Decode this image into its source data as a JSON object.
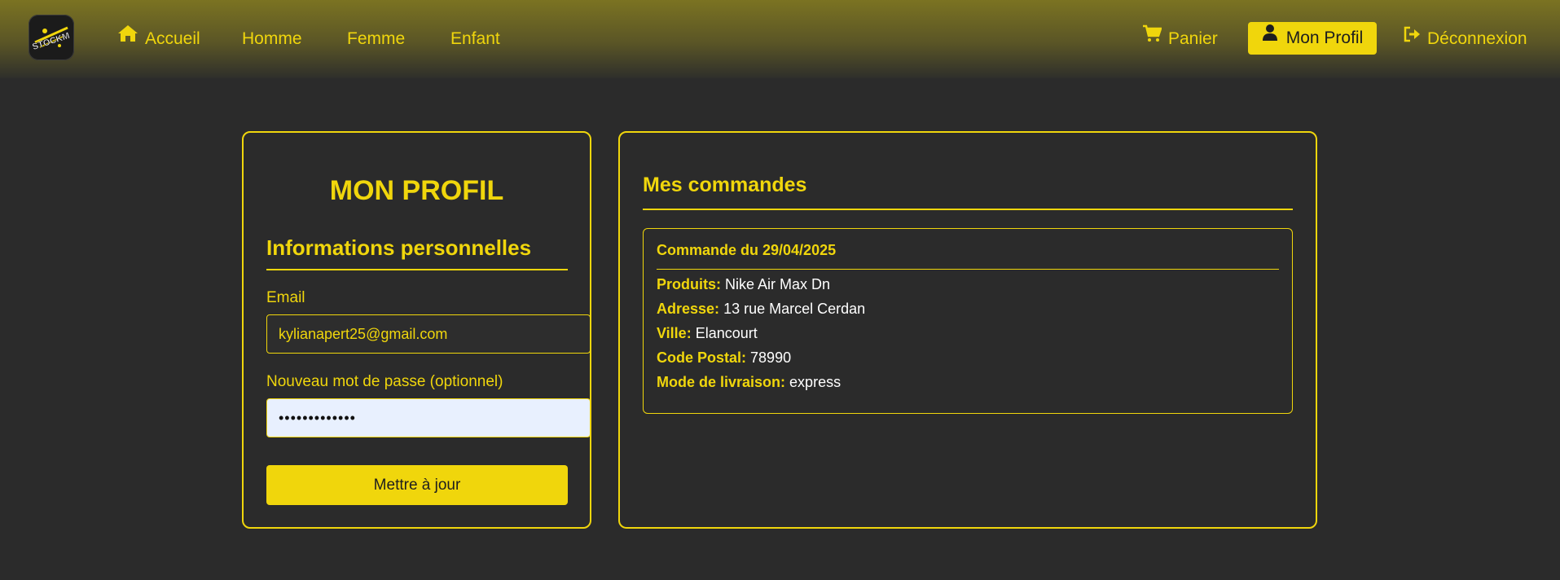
{
  "brand": {
    "logo_text": "STOCKM"
  },
  "nav": {
    "home": "Accueil",
    "men": "Homme",
    "women": "Femme",
    "kids": "Enfant",
    "cart": "Panier",
    "profile": "Mon Profil",
    "logout": "Déconnexion"
  },
  "icons": {
    "home": "home-icon",
    "cart": "cart-icon",
    "user": "user-icon",
    "logout": "logout-icon"
  },
  "colors": {
    "accent": "#f0d60c",
    "background": "#2b2b2b",
    "navbar_top": "#7b7322"
  },
  "profile": {
    "title": "MON PROFIL",
    "section_title": "Informations personnelles",
    "email_label": "Email",
    "email_value": "kylianapert25@gmail.com",
    "password_label": "Nouveau mot de passe (optionnel)",
    "password_value": "•••••••••••••",
    "submit_label": "Mettre à jour"
  },
  "orders": {
    "title": "Mes commandes",
    "items": [
      {
        "header": "Commande du 29/04/2025",
        "products_label": "Produits:",
        "products": "Nike Air Max Dn",
        "address_label": "Adresse:",
        "address": "13 rue Marcel Cerdan",
        "city_label": "Ville:",
        "city": "Elancourt",
        "postal_label": "Code Postal:",
        "postal": "78990",
        "delivery_label": "Mode de livraison:",
        "delivery": "express"
      }
    ]
  }
}
